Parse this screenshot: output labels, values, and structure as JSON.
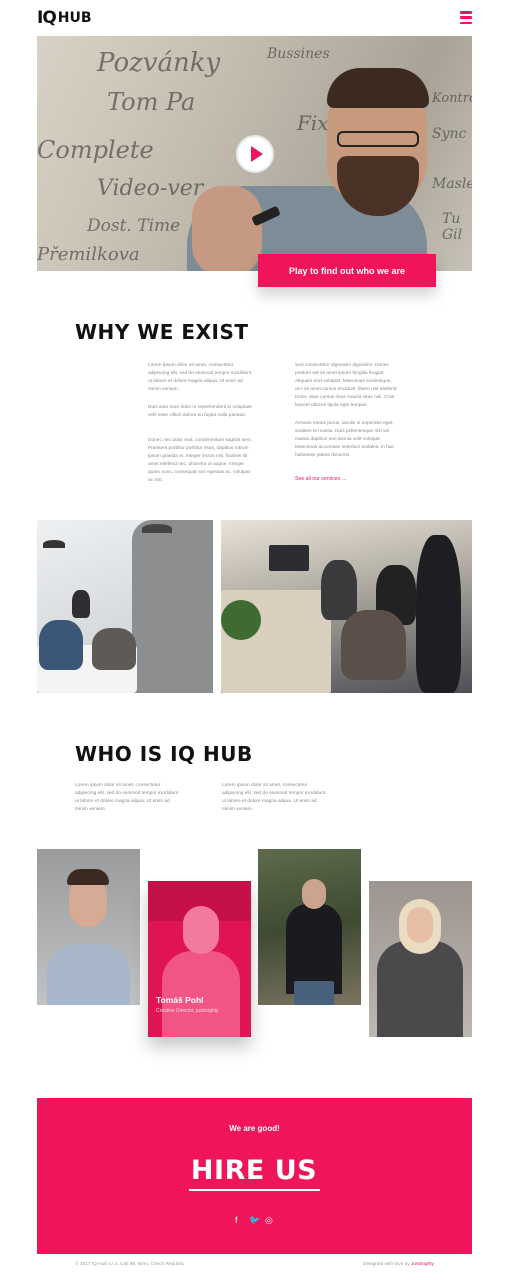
{
  "header": {
    "logo_iq": "IQ",
    "logo_hub": "HUB",
    "menu_icon": "hamburger-menu-icon"
  },
  "hero": {
    "glass_words": [
      "Pozvánky",
      "Tom Pa",
      "Complete",
      "Video-ver",
      "Dost. Time",
      "Přemilkova",
      "Bussines",
      "Sync",
      "Fix",
      "Tu Gil",
      "Masle",
      "Kontrola"
    ],
    "play_icon": "play-icon",
    "cta_label": "Play to find out who we are"
  },
  "why": {
    "title": "WHY WE EXIST",
    "col1": [
      "Lorem ipsum dolor sit amet, consectetur adipiscing elit, sed do eiusmod tempor incididunt ut labore et dolore magna aliqua. Ut enim ad minim veniam.",
      "Duis aute irure dolor in reprehenderit in voluptate velit esse cillum dolore eu fugiat nulla pariatur.",
      "Donec nec dolor erat, condimentum sagittis sem. Praesent porttitor porttitor risus, dapibus rutrum ipsum gravida et. Integer lectus nisi, facilisis sit amet eleifend nec, pharetra ut augue. Integer quam nunc, consequat non egestas ac, volutpat ac nisi."
    ],
    "col2": [
      "Sed consectetur dignissim dignissim. Donec pretium est sit amet ipsum fringilla feugiat. Aliquam erat volutpat. Maecenas scelerisque, orci sit amet cursus tincidunt, libero nisl eleifend tortor, vitae cursus risus mauris vitae nisi. Cras laoreet ultrices ligula eget tempus.",
      "Aenean metus purus, iaculis ut imperdiet eget, sodales et massa. Duis pellentesque nisl vel massa dapibus non lacinia velit volutpat. Maecenas accumsan interdum sodales. In hac habitasse platea dictumst."
    ],
    "link": "See all our services →"
  },
  "who": {
    "title": "WHO IS IQ HUB",
    "col1": "Lorem ipsum dolor sit amet, consectetur adipiscing elit, sed do eiusmod tempor incididunt ut labore et dolore magna aliqua. Ut enim ad minim veniam.",
    "col2": "Lorem ipsum dolor sit amet, consectetur adipiscing elit, sed do eiusmod tempor incididunt ut labore et dolore magna aliqua. Ut enim ad minim veniam."
  },
  "team": {
    "featured_name": "Tomáš Pohl",
    "featured_role": "Creative Director, justmighty"
  },
  "hire": {
    "small": "We are good!",
    "big": "HIRE US",
    "social": [
      "f",
      "🐦",
      "◎"
    ]
  },
  "footer": {
    "left": "© 2017 IQ Hub s.r.o, Cejl 99, Brno, Czech Republic",
    "right_prefix": "Designed with love by ",
    "right_brand": "Justmighty"
  }
}
